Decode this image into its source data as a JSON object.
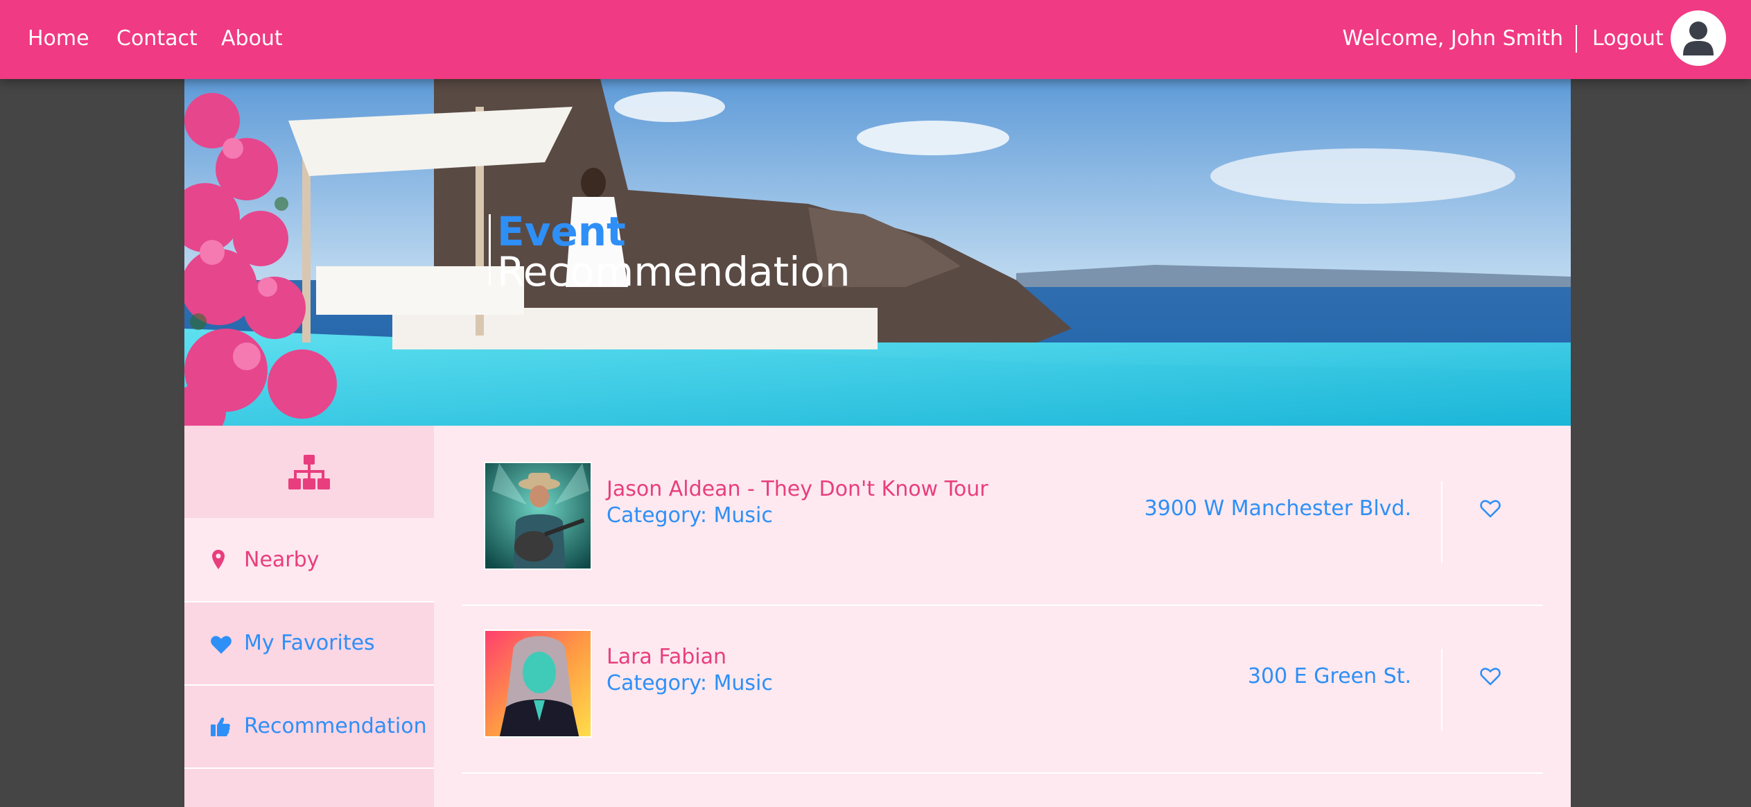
{
  "nav": {
    "links": [
      "Home",
      "Contact",
      "About"
    ],
    "welcome": "Welcome, John Smith",
    "logout": "Logout",
    "avatar_icon": "user-icon"
  },
  "hero": {
    "title_accent": "Event",
    "title_main": "Recommendation"
  },
  "sidebar": {
    "header_icon": "sitemap-icon",
    "items": [
      {
        "label": "Nearby",
        "icon": "map-pin-icon",
        "color": "#e83e7e"
      },
      {
        "label": "My Favorites",
        "icon": "heart-icon",
        "color": "#2e8ff7"
      },
      {
        "label": "Recommendation",
        "icon": "thumbs-up-icon",
        "color": "#2e8ff7"
      }
    ]
  },
  "events": [
    {
      "name": "Jason Aldean - They Don't Know Tour",
      "category": "Category: Music",
      "address": "3900 W Manchester Blvd.",
      "favorite_icon": "heart-outline-icon"
    },
    {
      "name": "Lara Fabian",
      "category": "Category: Music",
      "address": "300 E Green St.",
      "favorite_icon": "heart-outline-icon"
    }
  ],
  "colors": {
    "brand": "#f03a83",
    "accent_blue": "#2e8ff7",
    "panel_bg": "#fde9ef",
    "sidebar_bg": "#fbd6e3",
    "page_bg": "#454545"
  }
}
